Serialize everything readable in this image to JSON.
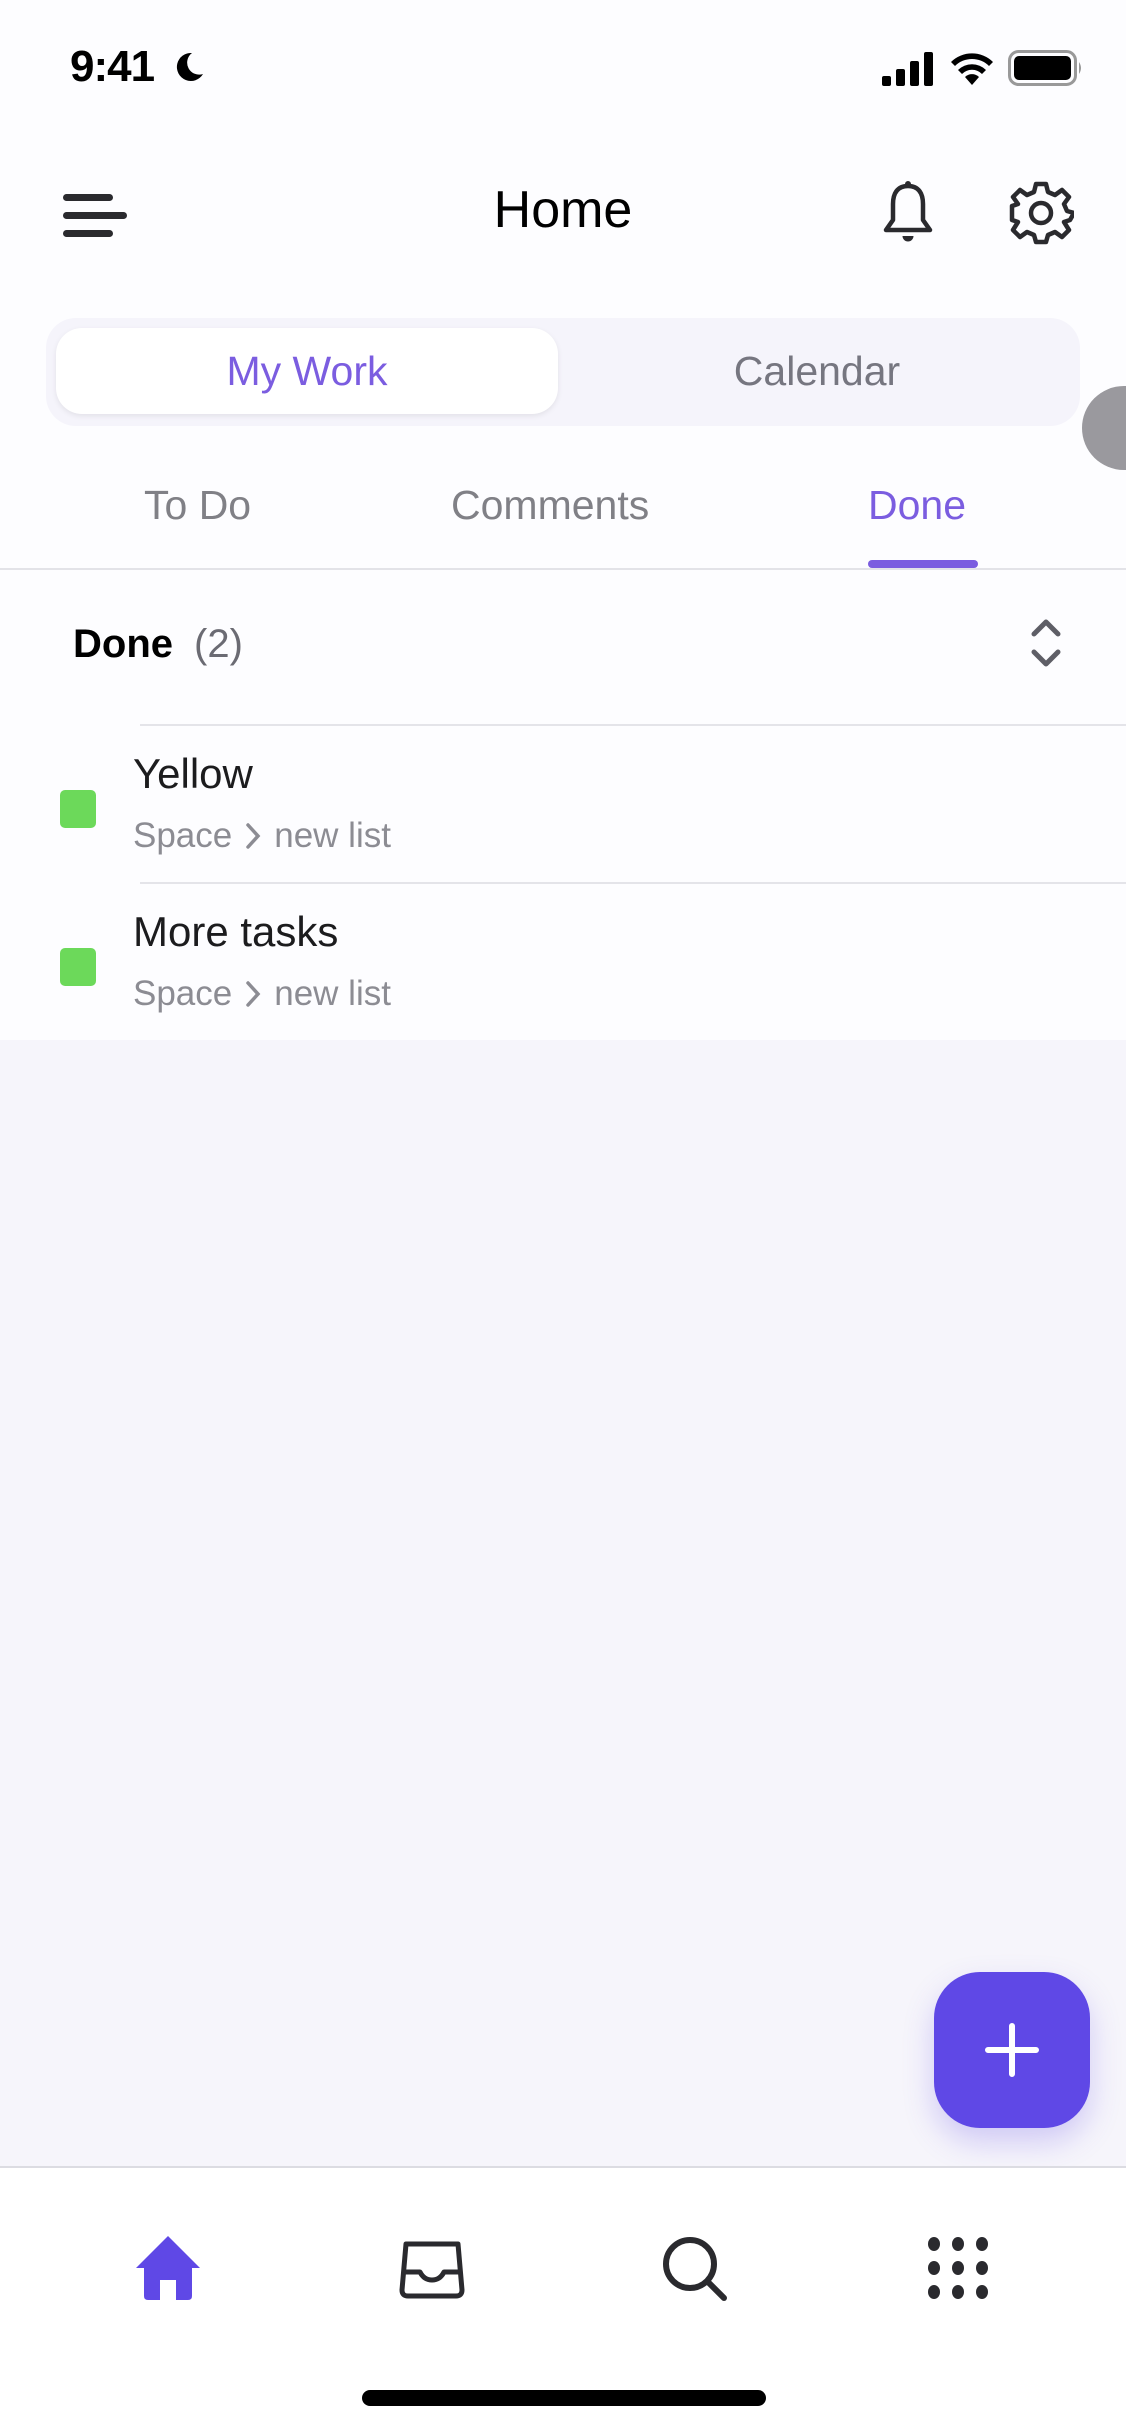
{
  "status_bar": {
    "time": "9:41",
    "moon_icon": "moon-icon",
    "signal_icon": "cellular-signal-icon",
    "wifi_icon": "wifi-icon",
    "battery_icon": "battery-icon"
  },
  "header": {
    "title": "Home",
    "menu_icon": "hamburger-menu-icon",
    "notifications_icon": "bell-icon",
    "settings_icon": "gear-icon"
  },
  "segment": {
    "options": [
      "My Work",
      "Calendar"
    ],
    "selected": "My Work"
  },
  "tabs": {
    "items": [
      "To Do",
      "Comments",
      "Done"
    ],
    "active": "Done"
  },
  "group": {
    "title": "Done",
    "count": "(2)",
    "sort_icon": "sort-up-down-icon"
  },
  "tasks": [
    {
      "name": "Yellow",
      "space": "Space",
      "list": "new list",
      "status_color": "#6cd95a"
    },
    {
      "name": "More tasks",
      "space": "Space",
      "list": "new list",
      "status_color": "#6cd95a"
    }
  ],
  "fab": {
    "icon": "plus-icon",
    "color": "#5f48e6"
  },
  "bottom_nav": {
    "items": [
      "home",
      "inbox",
      "search",
      "more"
    ],
    "active": "home"
  },
  "colors": {
    "accent": "#7b5de0",
    "fab": "#5f48e6",
    "done_status": "#6cd95a"
  }
}
